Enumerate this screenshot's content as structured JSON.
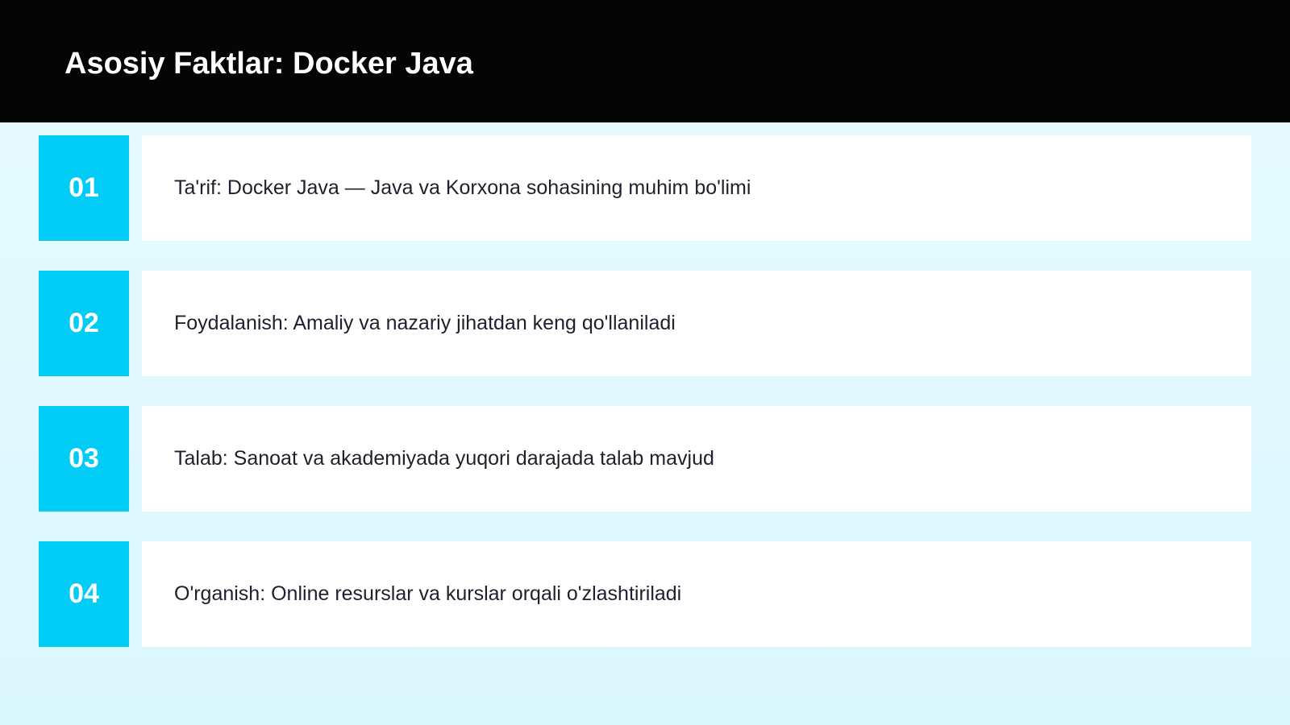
{
  "slide": {
    "title": "Asosiy Faktlar: Docker Java",
    "colors": {
      "header_background": "#050505",
      "number_box": "#00ccf5",
      "page_background": "#e4f9fd",
      "card_background": "#ffffff"
    },
    "items": [
      {
        "number": "01",
        "text": "Ta'rif: Docker Java — Java va Korxona sohasining muhim bo'limi"
      },
      {
        "number": "02",
        "text": "Foydalanish: Amaliy va nazariy jihatdan keng qo'llaniladi"
      },
      {
        "number": "03",
        "text": "Talab: Sanoat va akademiyada yuqori darajada talab mavjud"
      },
      {
        "number": "04",
        "text": "O'rganish: Online resurslar va kurslar orqali o'zlashtiriladi"
      }
    ]
  }
}
